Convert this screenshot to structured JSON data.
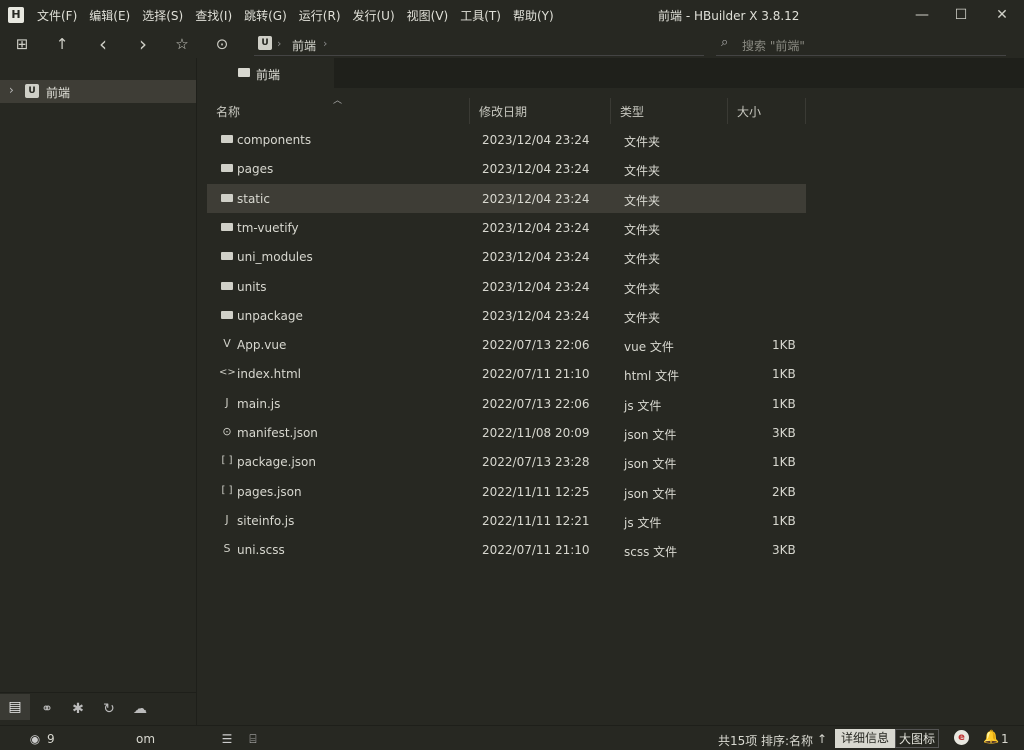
{
  "app": {
    "logo": "H",
    "window_title": "前端 - HBuilder X 3.8.12",
    "menu": [
      "文件(F)",
      "编辑(E)",
      "选择(S)",
      "查找(I)",
      "跳转(G)",
      "运行(R)",
      "发行(U)",
      "视图(V)",
      "工具(T)",
      "帮助(Y)"
    ],
    "window_buttons": {
      "minimize": "—",
      "maximize": "☐",
      "close": "✕"
    }
  },
  "toolbar": {
    "icons": {
      "new": "⊞",
      "up": "↑",
      "back": "‹",
      "forward": "›",
      "favorite": "☆",
      "run": "⊙"
    },
    "breadcrumb": {
      "badge": "U",
      "folder": "前端",
      "separator": "›"
    },
    "search_placeholder": "搜索 \"前端\"",
    "search_icon": "⌕"
  },
  "sidebar": {
    "project": {
      "chevron": "›",
      "badge": "U",
      "label": "前端"
    },
    "bottom_icons": [
      "▤",
      "⚭",
      "✱",
      "↻",
      "☁"
    ]
  },
  "tab": {
    "label": "前端"
  },
  "columns": {
    "name": "名称",
    "modified": "修改日期",
    "type": "类型",
    "size": "大小",
    "sort_arrow": "︿"
  },
  "files": [
    {
      "name": "components",
      "date": "2023/12/04 23:24",
      "type": "文件夹",
      "size": "",
      "icon": "folder"
    },
    {
      "name": "pages",
      "date": "2023/12/04 23:24",
      "type": "文件夹",
      "size": "",
      "icon": "folder"
    },
    {
      "name": "static",
      "date": "2023/12/04 23:24",
      "type": "文件夹",
      "size": "",
      "icon": "folder"
    },
    {
      "name": "tm-vuetify",
      "date": "2023/12/04 23:24",
      "type": "文件夹",
      "size": "",
      "icon": "folder"
    },
    {
      "name": "uni_modules",
      "date": "2023/12/04 23:24",
      "type": "文件夹",
      "size": "",
      "icon": "folder"
    },
    {
      "name": "units",
      "date": "2023/12/04 23:24",
      "type": "文件夹",
      "size": "",
      "icon": "folder"
    },
    {
      "name": "unpackage",
      "date": "2023/12/04 23:24",
      "type": "文件夹",
      "size": "",
      "icon": "folder"
    },
    {
      "name": "App.vue",
      "date": "2022/07/13 22:06",
      "type": "vue 文件",
      "size": "1KB",
      "icon": "V"
    },
    {
      "name": "index.html",
      "date": "2022/07/11 21:10",
      "type": "html 文件",
      "size": "1KB",
      "icon": "<>"
    },
    {
      "name": "main.js",
      "date": "2022/07/13 22:06",
      "type": "js 文件",
      "size": "1KB",
      "icon": "J"
    },
    {
      "name": "manifest.json",
      "date": "2022/11/08 20:09",
      "type": "json 文件",
      "size": "3KB",
      "icon": "⊙"
    },
    {
      "name": "package.json",
      "date": "2022/07/13 23:28",
      "type": "json 文件",
      "size": "1KB",
      "icon": "[ ]"
    },
    {
      "name": "pages.json",
      "date": "2022/11/11 12:25",
      "type": "json 文件",
      "size": "2KB",
      "icon": "[ ]"
    },
    {
      "name": "siteinfo.js",
      "date": "2022/11/11 12:21",
      "type": "js 文件",
      "size": "1KB",
      "icon": "J"
    },
    {
      "name": "uni.scss",
      "date": "2022/07/11 21:10",
      "type": "scss 文件",
      "size": "3KB",
      "icon": "S"
    }
  ],
  "status": {
    "user_icon": "◉",
    "user_text": "9",
    "user_suffix": "om",
    "list_icon": "☰",
    "terminal_icon": "⌸",
    "count": "共15项",
    "sort": "排序:名称",
    "sort_arrow": "↑",
    "view_detail": "详细信息",
    "view_large": "大图标",
    "badge": "e",
    "bell": "🔔",
    "notify_count": "1"
  },
  "colors": {
    "bg": "#272822",
    "selected_row": "#3e3d36",
    "accent_green": "#3fbf5a"
  }
}
